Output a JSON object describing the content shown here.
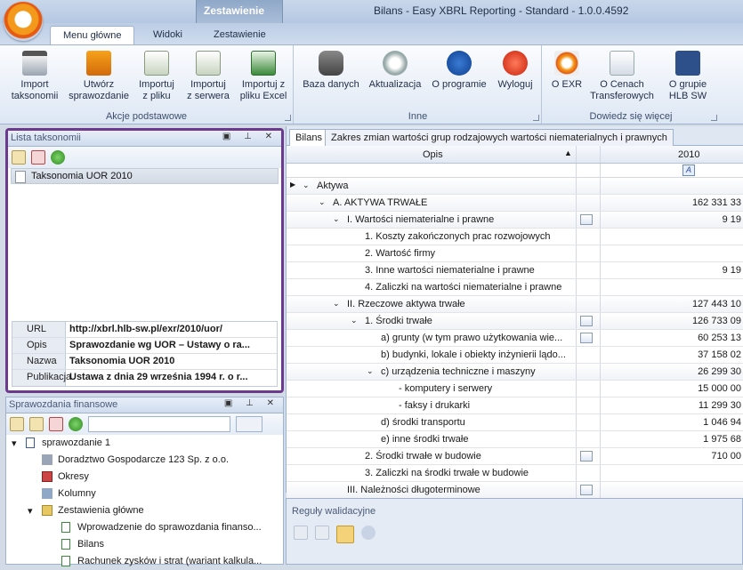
{
  "window": {
    "context_tab": "Zestawienie",
    "title": "Bilans - Easy XBRL Reporting - Standard - 1.0.0.4592"
  },
  "ribbon_tabs": [
    "Menu główne",
    "Widoki",
    "Zestawienie"
  ],
  "ribbon_groups": {
    "akcje": {
      "label": "Akcje podstawowe",
      "buttons": [
        "Import\ntaksonomii",
        "Utwórz\nsprawozdanie",
        "Importuj\nz pliku",
        "Importuj\nz serwera",
        "Importuj z\npliku Excel"
      ]
    },
    "inne": {
      "label": "Inne",
      "buttons": [
        "Baza danych",
        "Aktualizacja",
        "O programie",
        "Wyloguj"
      ]
    },
    "dowiedz": {
      "label": "Dowiedz się więcej",
      "buttons": [
        "O EXR",
        "O Cenach\nTransferowych",
        "O grupie\nHLB SW"
      ]
    }
  },
  "taxonomy_panel": {
    "title": "Lista taksonomii",
    "item": "Taksonomia UOR 2010",
    "props": [
      {
        "k": "URL",
        "v": "http://xbrl.hlb-sw.pl/exr/2010/uor/"
      },
      {
        "k": "Opis",
        "v": "Sprawozdanie wg UOR – Ustawy o ra..."
      },
      {
        "k": "Nazwa",
        "v": "Taksonomia UOR 2010"
      },
      {
        "k": "Publikacja",
        "v": "Ustawa z dnia 29 września 1994 r. o r..."
      }
    ]
  },
  "reports_panel": {
    "title": "Sprawozdania finansowe",
    "tree": [
      "sprawozdanie 1",
      "Doradztwo Gospodarcze 123 Sp. z o.o.",
      "Okresy",
      "Kolumny",
      "Zestawienia główne",
      "Wprowadzenie do sprawozdania finanso...",
      "Bilans",
      "Rachunek zysków i strat (wariant kalkula..."
    ]
  },
  "doc_tabs": [
    "Bilans",
    "Zakres zmian wartości grup rodzajowych wartości niematerialnych i prawnych"
  ],
  "grid": {
    "col_opis": "Opis",
    "col_year": "2010",
    "type_icon": "A",
    "rows": [
      {
        "t": "Aktywa",
        "v": ""
      },
      {
        "t": "A. AKTYWA TRWAŁE",
        "v": "162 331 33"
      },
      {
        "t": "I. Wartości niematerialne i prawne",
        "v": "9 19"
      },
      {
        "t": "1. Koszty zakończonych prac rozwojowych",
        "v": ""
      },
      {
        "t": "2. Wartość firmy",
        "v": ""
      },
      {
        "t": "3. Inne wartości niematerialne i prawne",
        "v": "9 19"
      },
      {
        "t": "4. Zaliczki na wartości niematerialne i prawne",
        "v": ""
      },
      {
        "t": "II. Rzeczowe aktywa trwałe",
        "v": "127 443 10"
      },
      {
        "t": "1. Środki trwałe",
        "v": "126 733 09"
      },
      {
        "t": "a) grunty (w tym prawo użytkowania wie...",
        "v": "60 253 13"
      },
      {
        "t": "b) budynki, lokale i obiekty inżynierii lądo...",
        "v": "37 158 02"
      },
      {
        "t": "c) urządzenia techniczne i maszyny",
        "v": "26 299 30"
      },
      {
        "t": "- komputery i serwery",
        "v": "15 000 00"
      },
      {
        "t": "- faksy i drukarki",
        "v": "11 299 30"
      },
      {
        "t": "d) środki transportu",
        "v": "1 046 94"
      },
      {
        "t": "e) inne środki trwałe",
        "v": "1 975 68"
      },
      {
        "t": "2. Środki trwałe w budowie",
        "v": "710 00"
      },
      {
        "t": "3. Zaliczki na środki trwałe w budowie",
        "v": ""
      },
      {
        "t": "III. Należności długoterminowe",
        "v": ""
      }
    ]
  },
  "validation": {
    "title": "Reguły walidacyjne"
  }
}
